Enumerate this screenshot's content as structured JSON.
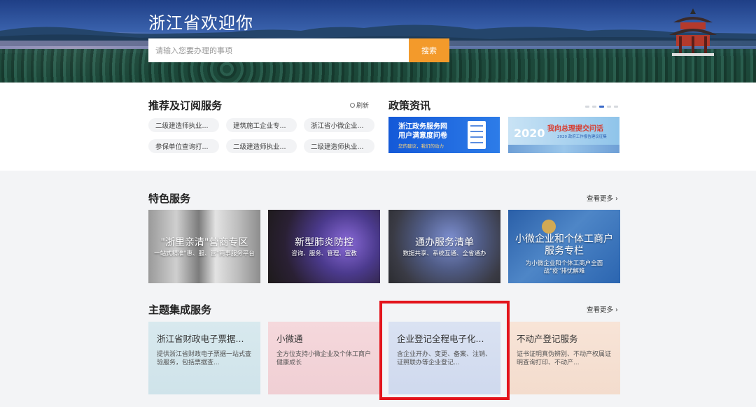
{
  "hero": {
    "title": "浙江省欢迎你",
    "search_placeholder": "请输入您要办理的事项",
    "search_button": "搜索"
  },
  "recommend": {
    "title": "推荐及订阅服务",
    "refresh_label": "刷新",
    "items": [
      {
        "label": "二级建造师执业..."
      },
      {
        "label": "建筑施工企业专..."
      },
      {
        "label": "浙江省小微企业..."
      },
      {
        "label": "参保单位查询打..."
      },
      {
        "label": "二级建造师执业..."
      },
      {
        "label": "二级建造师执业..."
      }
    ]
  },
  "policy": {
    "title": "政策资讯",
    "carousel_active_index": 4,
    "banner1": {
      "line1": "浙江政务服务网",
      "line2": "用户满意度问卷",
      "sub": "您的建议，我们的动力"
    },
    "banner2": {
      "title": "我向总理提交问话",
      "sub": "2020 政府工作报告建议征集",
      "num": "2020"
    }
  },
  "featured": {
    "title": "特色服务",
    "more_label": "查看更多",
    "cards": [
      {
        "title": "\"浙里亲清\"营商专区",
        "subtitle": "一站式精准\"惠、服、管\"商事服务平台"
      },
      {
        "title": "新型肺炎防控",
        "subtitle": "咨询、服务、管理、宣教"
      },
      {
        "title": "通办服务清单",
        "subtitle": "数据共享、系统互通、全省通办"
      },
      {
        "title": "小微企业和个体工商户服务专栏",
        "subtitle": "为小微企业和个体工商户全面战\"疫\"排忧解难"
      }
    ]
  },
  "theme": {
    "title": "主题集成服务",
    "more_label": "查看更多",
    "cards": [
      {
        "title": "浙江省财政电子票据...",
        "desc": "提供浙江省财政电子票据一站式查验服务，包括票据查..."
      },
      {
        "title": "小微通",
        "desc": "全方位支持小微企业及个体工商户健康成长"
      },
      {
        "title": "企业登记全程电子化...",
        "desc": "含企业开办、变更、备案、注销、证照联办等企业登记..."
      },
      {
        "title": "不动产登记服务",
        "desc": "证书证明真伪辨别、不动产权属证明查询打印、不动产..."
      }
    ]
  },
  "colors": {
    "accent_orange": "#f39a2b",
    "highlight_red": "#e3141b",
    "carousel_active": "#3b6bc9"
  }
}
